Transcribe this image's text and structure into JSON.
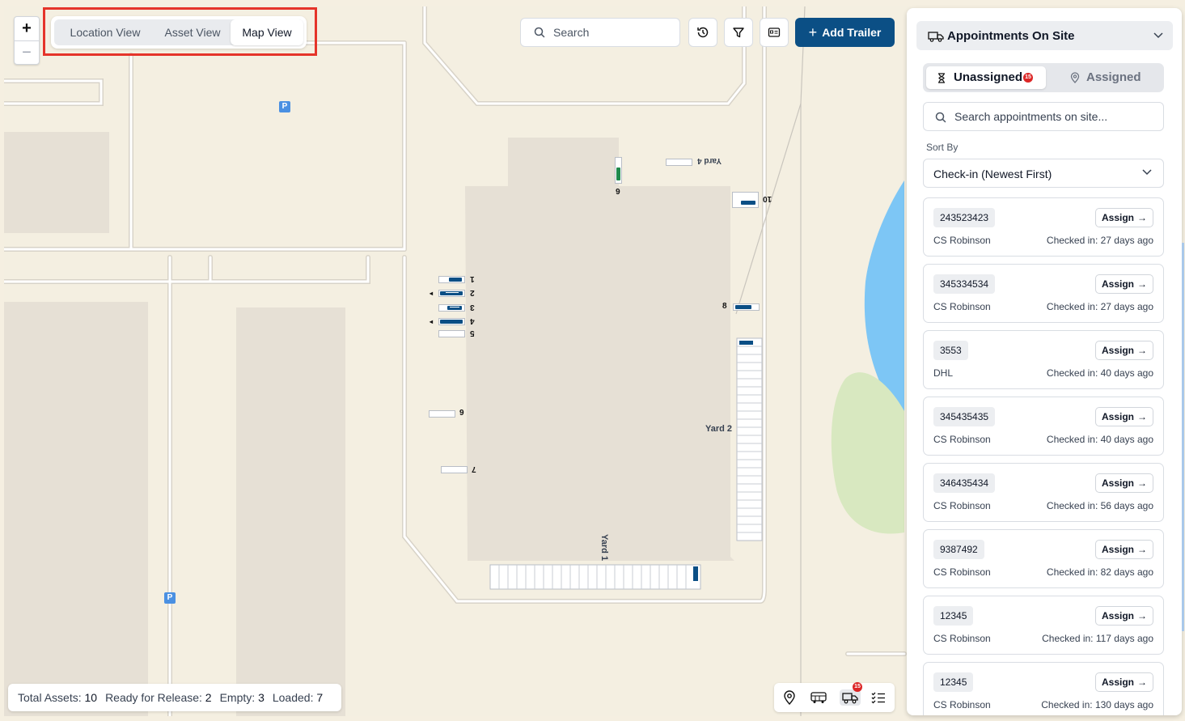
{
  "view_toggle": {
    "location": "Location View",
    "asset": "Asset View",
    "map": "Map View",
    "active": "Map View"
  },
  "zoom": {
    "in": "+",
    "out": "−"
  },
  "search": {
    "placeholder": "Search"
  },
  "toolbar": {
    "add_trailer_label": "Add Trailer",
    "icons": [
      "history-icon",
      "filter-icon",
      "id-card-icon"
    ]
  },
  "map": {
    "parking_label": "P",
    "yards": {
      "yard1": "Yard 1",
      "yard2": "Yard 2",
      "yard4": "Yard 4"
    },
    "slot_numbers": [
      "1",
      "2",
      "3",
      "4",
      "5",
      "6",
      "7",
      "8",
      "9",
      "10"
    ]
  },
  "stats": {
    "total_label": "Total Assets:",
    "total": "10",
    "ready_label": "Ready for Release:",
    "ready": "2",
    "empty_label": "Empty:",
    "empty": "3",
    "loaded_label": "Loaded:",
    "loaded": "7"
  },
  "bottom_toolbar": {
    "badge": "15",
    "icons": [
      "location-pin-icon",
      "bus-icon",
      "truck-icon",
      "checklist-icon"
    ]
  },
  "panel": {
    "title": "Appointments On Site",
    "tabs": {
      "unassigned": "Unassigned",
      "unassigned_count": "15",
      "assigned": "Assigned"
    },
    "search_placeholder": "Search appointments on site...",
    "sort_label": "Sort By",
    "sort_value": "Check-in (Newest First)",
    "assign_label": "Assign",
    "appointments": [
      {
        "id": "243523423",
        "carrier": "CS Robinson",
        "checked": "Checked in: 27 days ago"
      },
      {
        "id": "345334534",
        "carrier": "CS Robinson",
        "checked": "Checked in: 27 days ago"
      },
      {
        "id": "3553",
        "carrier": "DHL",
        "checked": "Checked in: 40 days ago"
      },
      {
        "id": "345435435",
        "carrier": "CS Robinson",
        "checked": "Checked in: 40 days ago"
      },
      {
        "id": "346435434",
        "carrier": "CS Robinson",
        "checked": "Checked in: 56 days ago"
      },
      {
        "id": "9387492",
        "carrier": "CS Robinson",
        "checked": "Checked in: 82 days ago"
      },
      {
        "id": "12345",
        "carrier": "CS Robinson",
        "checked": "Checked in: 117 days ago"
      },
      {
        "id": "12345",
        "carrier": "CS Robinson",
        "checked": "Checked in: 130 days ago"
      }
    ]
  },
  "colors": {
    "primary": "#0b4f85",
    "badge": "#dc2626",
    "water": "#7dc6f5",
    "park": "#d8e8c0",
    "building": "#e6e0d5"
  }
}
